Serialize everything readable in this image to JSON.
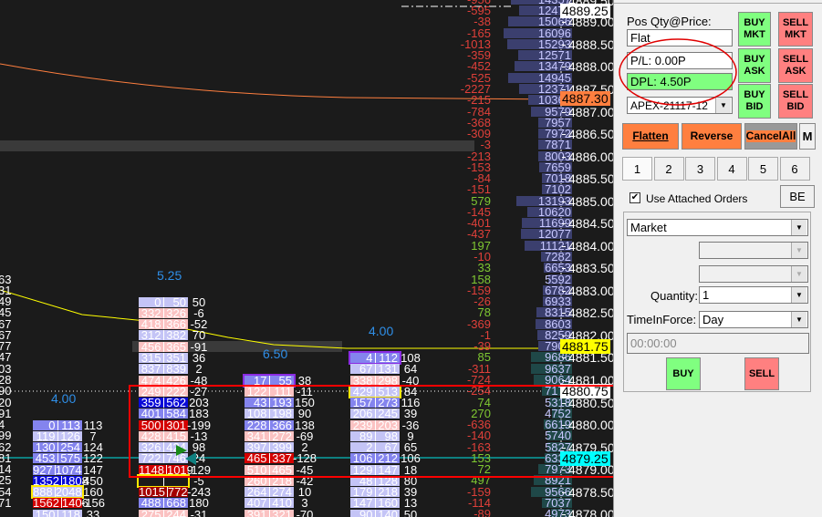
{
  "ladder": [
    {
      "price": "4889.50",
      "delta": "-956",
      "volume": "14357"
    },
    {
      "price": "4889.25",
      "delta": "-595",
      "volume": "12478"
    },
    {
      "price": "4889.00",
      "delta": "-38",
      "volume": "15066"
    },
    {
      "price": "4888.75",
      "delta": "-165",
      "volume": "16096"
    },
    {
      "price": "4888.50",
      "delta": "-1013",
      "volume": "15293"
    },
    {
      "price": "4888.25",
      "delta": "-359",
      "volume": "12571"
    },
    {
      "price": "4888.00",
      "delta": "-452",
      "volume": "13479"
    },
    {
      "price": "4887.75",
      "delta": "-525",
      "volume": "14945"
    },
    {
      "price": "4887.50",
      "delta": "-2227",
      "volume": "12371"
    },
    {
      "price": "4887.25",
      "delta": "-215",
      "volume": "10369"
    },
    {
      "price": "4887.00",
      "delta": "-784",
      "volume": "9579"
    },
    {
      "price": "4886.75",
      "delta": "-368",
      "volume": "7957"
    },
    {
      "price": "4886.50",
      "delta": "-309",
      "volume": "7972"
    },
    {
      "price": "4886.25",
      "delta": "-3",
      "volume": "7871"
    },
    {
      "price": "4886.00",
      "delta": "-213",
      "volume": "8003"
    },
    {
      "price": "4885.75",
      "delta": "-153",
      "volume": "7659"
    },
    {
      "price": "4885.50",
      "delta": "-84",
      "volume": "7018"
    },
    {
      "price": "4885.25",
      "delta": "-151",
      "volume": "7102"
    },
    {
      "price": "4885.00",
      "delta": "579",
      "volume": "13193"
    },
    {
      "price": "4884.75",
      "delta": "-145",
      "volume": "10620"
    },
    {
      "price": "4884.50",
      "delta": "-401",
      "volume": "11699"
    },
    {
      "price": "4884.25",
      "delta": "-437",
      "volume": "12077"
    },
    {
      "price": "4884.00",
      "delta": "197",
      "volume": "11121"
    },
    {
      "price": "4883.75",
      "delta": "-10",
      "volume": "7282"
    },
    {
      "price": "4883.50",
      "delta": "33",
      "volume": "6653"
    },
    {
      "price": "4883.25",
      "delta": "158",
      "volume": "5592"
    },
    {
      "price": "4883.00",
      "delta": "-159",
      "volume": "6782"
    },
    {
      "price": "4882.75",
      "delta": "-26",
      "volume": "6933"
    },
    {
      "price": "4882.50",
      "delta": "78",
      "volume": "8315"
    },
    {
      "price": "4882.25",
      "delta": "-369",
      "volume": "8603"
    },
    {
      "price": "4882.00",
      "delta": "-1",
      "volume": "8259"
    },
    {
      "price": "4881.75",
      "delta": "-39",
      "volume": "7902"
    },
    {
      "price": "4881.50",
      "delta": "85",
      "volume": "9686"
    },
    {
      "price": "4881.25",
      "delta": "-311",
      "volume": "9637"
    },
    {
      "price": "4881.00",
      "delta": "-724",
      "volume": "9064"
    },
    {
      "price": "4880.75",
      "delta": "-254",
      "volume": "7179"
    },
    {
      "price": "4880.50",
      "delta": "74",
      "volume": "5318"
    },
    {
      "price": "4880.25",
      "delta": "270",
      "volume": "4752"
    },
    {
      "price": "4880.00",
      "delta": "-636",
      "volume": "6619"
    },
    {
      "price": "4879.75",
      "delta": "-140",
      "volume": "5740"
    },
    {
      "price": "4879.50",
      "delta": "-163",
      "volume": "5827"
    },
    {
      "price": "4879.25",
      "delta": "153",
      "volume": "6335"
    },
    {
      "price": "4879.00",
      "delta": "72",
      "volume": "7973"
    },
    {
      "price": "4878.75",
      "delta": "497",
      "volume": "8921"
    },
    {
      "price": "4878.50",
      "delta": "-159",
      "volume": "9566"
    },
    {
      "price": "4878.25",
      "delta": "-114",
      "volume": "7037"
    },
    {
      "price": "4878.00",
      "delta": "-89",
      "volume": "4973"
    }
  ],
  "axis_labels": [
    "4889.00",
    "4888.50",
    "4888.00",
    "4887.50",
    "4887.00",
    "4886.50",
    "4886.00",
    "4885.50",
    "4885.00",
    "4884.50",
    "4884.00",
    "4883.50",
    "4883.00",
    "4882.50",
    "4882.00",
    "4881.50",
    "4881.00",
    "4880.50",
    "4880.00",
    "4879.50",
    "4879.00",
    "4878.50",
    "4878.00"
  ],
  "price_markers": [
    {
      "price": "4889.25",
      "color": "#ffffff"
    },
    {
      "price": "4887.30",
      "color": "#ff7f3f"
    },
    {
      "price": "4881.75",
      "color": "#ffff00"
    },
    {
      "price": "4880.75",
      "color": "#ffffff"
    },
    {
      "price": "4879.25",
      "color": "#00ffff"
    }
  ],
  "left_partial_deltas": [
    "63",
    "31",
    "49",
    "45",
    "67",
    "67",
    "77",
    "47",
    "03",
    "28",
    "90",
    "20",
    "91",
    "4",
    "99",
    "62",
    "81",
    "14",
    "25",
    "54",
    "71"
  ],
  "bars": [
    {
      "header": "4.00",
      "top_price": "4880.00",
      "rows": [
        [
          "0",
          "113",
          "113",
          "mb"
        ],
        [
          "119",
          "126",
          "7",
          "lb"
        ],
        [
          "130",
          "254",
          "124",
          "mb"
        ],
        [
          "453",
          "575",
          "122",
          "mb"
        ],
        [
          "927",
          "1074",
          "147",
          "mb"
        ],
        [
          "1352",
          "1808",
          "450",
          "db"
        ],
        [
          "888",
          "2048",
          "160",
          "lb yb"
        ],
        [
          "1562",
          "1406",
          "-156",
          "rd"
        ],
        [
          "150",
          "118",
          "33",
          "lb"
        ]
      ]
    },
    {
      "header": "5.25",
      "top_price": "4882.75",
      "rows": [
        [
          "0",
          "50",
          "50",
          "lb"
        ],
        [
          "332",
          "326",
          "-6",
          "pk"
        ],
        [
          "418",
          "366",
          "-52",
          "pk"
        ],
        [
          "312",
          "382",
          "70",
          "lb"
        ],
        [
          "456",
          "365",
          "-91",
          "pk"
        ],
        [
          "315",
          "351",
          "36",
          "lb"
        ],
        [
          "837",
          "839",
          "2",
          "lb"
        ],
        [
          "474",
          "426",
          "-48",
          "pk"
        ],
        [
          "249",
          "222",
          "-27",
          "pk"
        ],
        [
          "359",
          "562",
          "203",
          "db"
        ],
        [
          "401",
          "584",
          "183",
          "mb"
        ],
        [
          "500",
          "301",
          "-199",
          "rd"
        ],
        [
          "428",
          "415",
          "-13",
          "pk"
        ],
        [
          "326",
          "424",
          "98",
          "lb"
        ],
        [
          "722",
          "746",
          "24",
          "lb"
        ],
        [
          "1148",
          "1019",
          "-129",
          "rd"
        ],
        [
          "",
          "",
          "-5",
          "yb"
        ],
        [
          "1015",
          "772",
          "-243",
          "dr"
        ],
        [
          "488",
          "668",
          "180",
          "mb"
        ],
        [
          "275",
          "244",
          "-31",
          "pk"
        ]
      ]
    },
    {
      "header": "6.50",
      "top_price": "4881.00",
      "rows": [
        [
          "17",
          "55",
          "38",
          "mb pb"
        ],
        [
          "122",
          "111",
          "-11",
          "pk"
        ],
        [
          "43",
          "193",
          "150",
          "mb"
        ],
        [
          "108",
          "198",
          "90",
          "lb"
        ],
        [
          "228",
          "366",
          "138",
          "mb"
        ],
        [
          "341",
          "272",
          "-69",
          "pk"
        ],
        [
          "397",
          "399",
          "2",
          "lb"
        ],
        [
          "465",
          "337",
          "-128",
          "rd"
        ],
        [
          "510",
          "465",
          "-45",
          "pk"
        ],
        [
          "260",
          "218",
          "-42",
          "pk"
        ],
        [
          "264",
          "274",
          "10",
          "lb"
        ],
        [
          "407",
          "410",
          "3",
          "lb"
        ],
        [
          "391",
          "321",
          "-70",
          "pk"
        ]
      ]
    },
    {
      "header": "4.00",
      "top_price": "4881.50",
      "rows": [
        [
          "4",
          "112",
          "108",
          "mb pb"
        ],
        [
          "67",
          "131",
          "64",
          "lb"
        ],
        [
          "338",
          "298",
          "-40",
          "pk"
        ],
        [
          "429",
          "513",
          "84",
          "lb yb"
        ],
        [
          "157",
          "273",
          "116",
          "mb"
        ],
        [
          "206",
          "245",
          "39",
          "lb"
        ],
        [
          "239",
          "203",
          "-36",
          "pk"
        ],
        [
          "89",
          "98",
          "9",
          "lb"
        ],
        [
          "2",
          "67",
          "65",
          "lb"
        ],
        [
          "106",
          "212",
          "106",
          "mb"
        ],
        [
          "129",
          "147",
          "18",
          "lb"
        ],
        [
          "48",
          "128",
          "80",
          "lb"
        ],
        [
          "179",
          "218",
          "39",
          "lb"
        ],
        [
          "147",
          "160",
          "13",
          "lb"
        ],
        [
          "90",
          "140",
          "50",
          "lb"
        ]
      ]
    }
  ],
  "panel": {
    "pos_label": "Pos Qty@Price:",
    "pos_value": "Flat",
    "pl": "P/L: 0.00P",
    "dpl": "DPL: 4.50P",
    "account": "APEX-21117-12",
    "buy_mkt": "BUY MKT",
    "sell_mkt": "SELL MKT",
    "buy_ask": "BUY ASK",
    "sell_ask": "SELL ASK",
    "buy_bid": "BUY BID",
    "sell_bid": "SELL BID",
    "flatten": "Flatten",
    "reverse": "Reverse",
    "cancel_all": "CancelAll",
    "m": "M",
    "tabs": [
      "1",
      "2",
      "3",
      "4",
      "5",
      "6"
    ],
    "use_attached": "Use Attached Orders",
    "use_attached_checked": true,
    "be": "BE",
    "order_type": "Market",
    "quantity_label": "Quantity:",
    "quantity": "1",
    "tif_label": "TimeInForce:",
    "tif": "Day",
    "time": "00:00:00",
    "buy": "BUY",
    "sell": "SELL"
  },
  "colors": {
    "buy": "#80ff80",
    "sell": "#ff8080",
    "action": "#ff7f3f",
    "vwap": "#ff7f3f",
    "line": "#ffff00",
    "highlight_box": "#ff0000"
  }
}
